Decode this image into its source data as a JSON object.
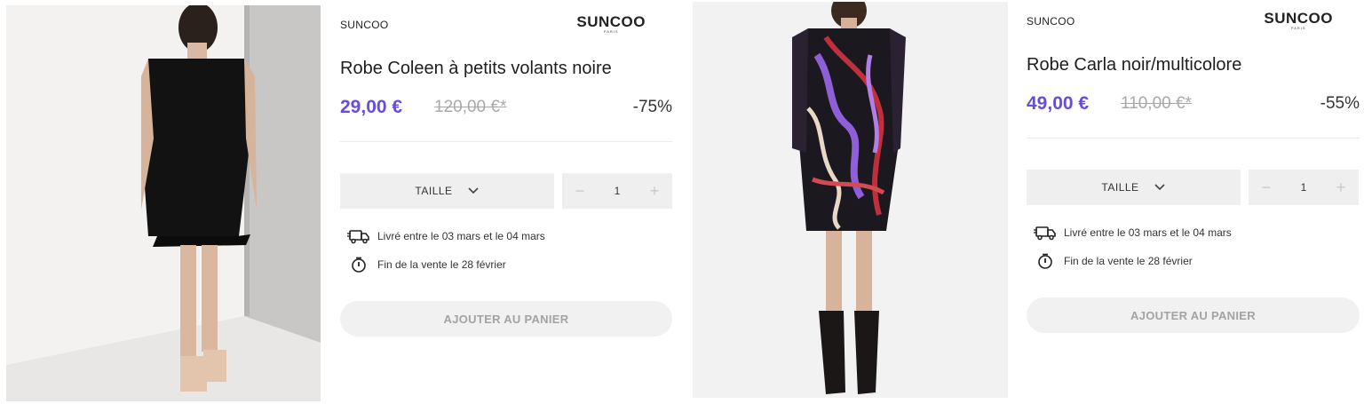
{
  "products": [
    {
      "brand": "SUNCOO",
      "logo": {
        "word": "SUNCOO",
        "sub": "PARIS"
      },
      "title": "Robe Coleen à petits volants noire",
      "price": "29,00 €",
      "old_price": "120,00 €*",
      "discount": "-75%",
      "size_label": "TAILLE",
      "quantity": "1",
      "qty_minus": "−",
      "qty_plus": "+",
      "delivery": "Livré entre le 03 mars et le 04 mars",
      "sale_end": "Fin de la vente le 28 février",
      "add_to_cart": "AJOUTER AU PANIER",
      "image": "black sleeveless dress with ruffles",
      "icons": [
        "chevron-down-icon",
        "delivery-truck-icon",
        "stopwatch-icon"
      ]
    },
    {
      "brand": "SUNCOO",
      "logo": {
        "word": "SUNCOO",
        "sub": "PARIS"
      },
      "title": "Robe Carla noir/multicolore",
      "price": "49,00 €",
      "old_price": "110,00 €*",
      "discount": "-55%",
      "size_label": "TAILLE",
      "quantity": "1",
      "qty_minus": "−",
      "qty_plus": "+",
      "delivery": "Livré entre le 03 mars et le 04 mars",
      "sale_end": "Fin de la vente le 28 février",
      "add_to_cart": "AJOUTER AU PANIER",
      "image": "black multicolor printed wrap dress with boots",
      "icons": [
        "chevron-down-icon",
        "delivery-truck-icon",
        "stopwatch-icon"
      ]
    }
  ],
  "colors": {
    "price": "#6a4be0",
    "old_price": "#a8a8a8",
    "control_bg": "#efefef",
    "button_bg": "#f1f1f1",
    "button_text": "#a3a3a3"
  }
}
